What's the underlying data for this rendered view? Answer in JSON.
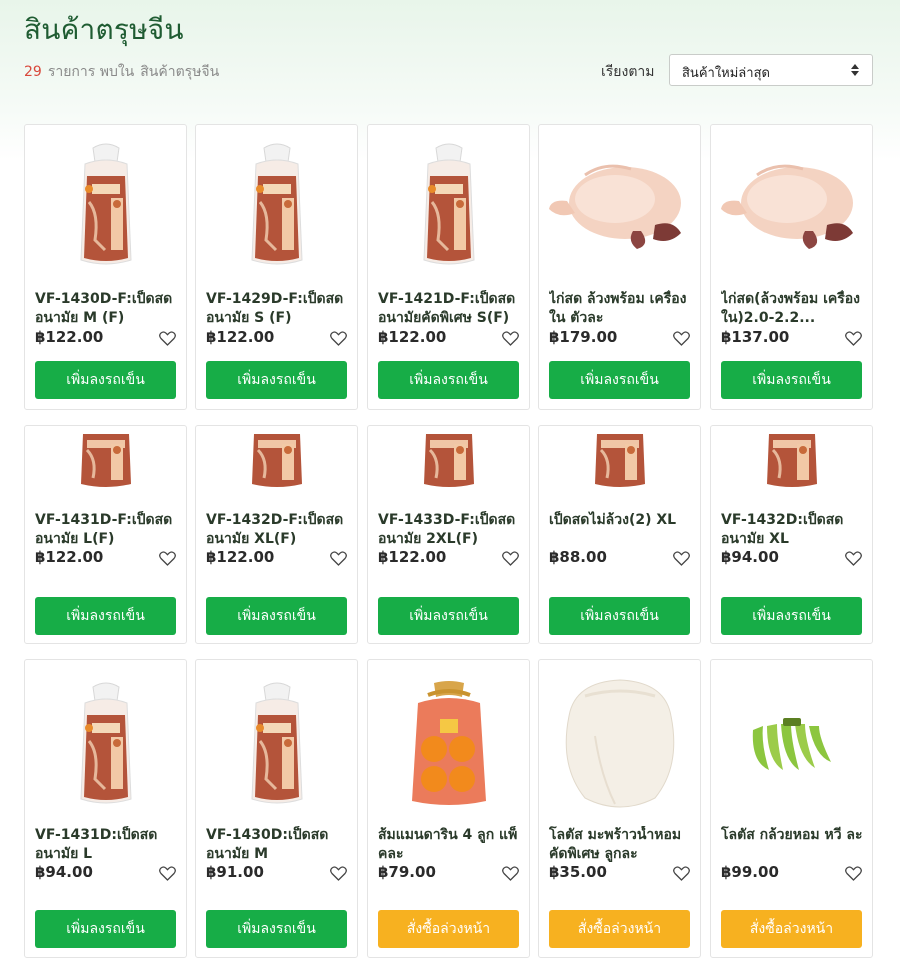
{
  "header": {
    "title": "สินค้าตรุษจีน",
    "result_count": "29",
    "result_text": "รายการ พบใน",
    "category": "สินค้าตรุษจีน",
    "sort_label": "เรียงตาม",
    "sort_value": "สินค้าใหม่ล่าสุด"
  },
  "colors": {
    "accent_green": "#17ad47",
    "accent_orange": "#f7b120",
    "count_red": "#d9483b",
    "title_green": "#1f5c32"
  },
  "products": [
    {
      "name": "VF-1430D-F:เป็ดสด อนามัย M (F)",
      "price": "฿122.00",
      "button": "เพิ่มลงรถเข็น",
      "image": "packaged-duck"
    },
    {
      "name": "VF-1429D-F:เป็ดสด อนามัย S (F)",
      "price": "฿122.00",
      "button": "เพิ่มลงรถเข็น",
      "image": "packaged-duck"
    },
    {
      "name": "VF-1421D-F:เป็ดสด อนามัยคัดพิเศษ S(F)",
      "price": "฿122.00",
      "button": "เพิ่มลงรถเข็น",
      "image": "packaged-duck"
    },
    {
      "name": "ไก่สด ล้วงพร้อม เครื่องใน ตัวละ",
      "price": "฿179.00",
      "button": "เพิ่มลงรถเข็น",
      "image": "whole-chicken"
    },
    {
      "name": "ไก่สด(ล้วงพร้อม เครื่องใน)2.0-2.2...",
      "price": "฿137.00",
      "button": "เพิ่มลงรถเข็น",
      "image": "whole-chicken"
    },
    {
      "name": "VF-1431D-F:เป็ดสด อนามัย L(F)",
      "price": "฿122.00",
      "button": "เพิ่มลงรถเข็น",
      "image": "packaged-duck-cropped"
    },
    {
      "name": "VF-1432D-F:เป็ดสด อนามัย XL(F)",
      "price": "฿122.00",
      "button": "เพิ่มลงรถเข็น",
      "image": "packaged-duck-cropped"
    },
    {
      "name": "VF-1433D-F:เป็ดสด อนามัย 2XL(F)",
      "price": "฿122.00",
      "button": "เพิ่มลงรถเข็น",
      "image": "packaged-duck-cropped"
    },
    {
      "name": "เป็ดสดไม่ล้วง(2) XL",
      "price": "฿88.00",
      "button": "เพิ่มลงรถเข็น",
      "image": "packaged-duck-cropped"
    },
    {
      "name": "VF-1432D:เป็ดสด อนามัย XL",
      "price": "฿94.00",
      "button": "เพิ่มลงรถเข็น",
      "image": "packaged-duck-cropped"
    },
    {
      "name": "VF-1431D:เป็ดสด อนามัย L",
      "price": "฿94.00",
      "button": "เพิ่มลงรถเข็น",
      "image": "packaged-duck"
    },
    {
      "name": "VF-1430D:เป็ดสด อนามัย M",
      "price": "฿91.00",
      "button": "เพิ่มลงรถเข็น",
      "image": "packaged-duck"
    },
    {
      "name": "ส้มแมนดาริน 4 ลูก แพ็คละ",
      "price": "฿79.00",
      "button": "สั่งซื้อล่วงหน้า",
      "image": "mandarin-bag"
    },
    {
      "name": "โลตัส มะพร้าวน้ำหอม คัดพิเศษ ลูกละ",
      "price": "฿35.00",
      "button": "สั่งซื้อล่วงหน้า",
      "image": "coconut"
    },
    {
      "name": "โลตัส กล้วยหอม หวี ละ",
      "price": "฿99.00",
      "button": "สั่งซื้อล่วงหน้า",
      "image": "bananas"
    }
  ]
}
